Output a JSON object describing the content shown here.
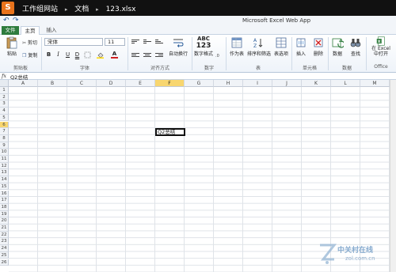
{
  "titlebar": {
    "logo": "S",
    "crumbs": [
      "工作组网站",
      "文档",
      "123.xlsx"
    ]
  },
  "app_name": "Microsoft Excel Web App",
  "tabs": {
    "file": "文件",
    "home": "主页",
    "insert": "插入"
  },
  "ribbon": {
    "clipboard": {
      "paste": "粘贴",
      "cut": "剪切",
      "copy": "复制",
      "label": "剪贴板"
    },
    "font": {
      "family": "宋体",
      "size": "11",
      "bold": "B",
      "italic": "I",
      "underline": "U",
      "double_underline": "D",
      "label": "字体"
    },
    "alignment": {
      "wrap": "自动换行",
      "label": "对齐方式"
    },
    "number": {
      "format": "数字格式",
      "sample": "ABC",
      "sample2": "123",
      "label": "数字"
    },
    "table": {
      "as_table": "作为表",
      "sort_filter": "排序和筛选",
      "table_options": "表选项",
      "label": "表"
    },
    "cells": {
      "insert": "插入",
      "delete": "删除",
      "label": "单元格"
    },
    "data": {
      "data": "数据",
      "find": "查找",
      "label": "数据"
    },
    "office": {
      "open_in_excel_1": "在 Excel",
      "open_in_excel_2": "中打开",
      "label": "Office"
    }
  },
  "formula_bar": {
    "fx": "fx",
    "value": "Q2总结"
  },
  "grid": {
    "columns": [
      "A",
      "B",
      "C",
      "D",
      "E",
      "F",
      "G",
      "H",
      "I",
      "J",
      "K",
      "L",
      "M"
    ],
    "selected_column": "F",
    "rows": [
      "1",
      "2",
      "3",
      "4",
      "5",
      "6",
      "7",
      "8",
      "9",
      "10",
      "11",
      "12",
      "13",
      "14",
      "15",
      "16",
      "17",
      "18",
      "19",
      "20",
      "21",
      "22",
      "23",
      "24",
      "25",
      "26"
    ],
    "selected_row": "6",
    "active_cell_value": "Q2总结"
  },
  "watermark": {
    "text": "中关村在线",
    "url": "zol.com.cn"
  },
  "colors": {
    "title_bg": "#111111",
    "file_tab": "#2f7c3d",
    "selected_header": "#f8d66f",
    "logo": "#e8731c"
  }
}
